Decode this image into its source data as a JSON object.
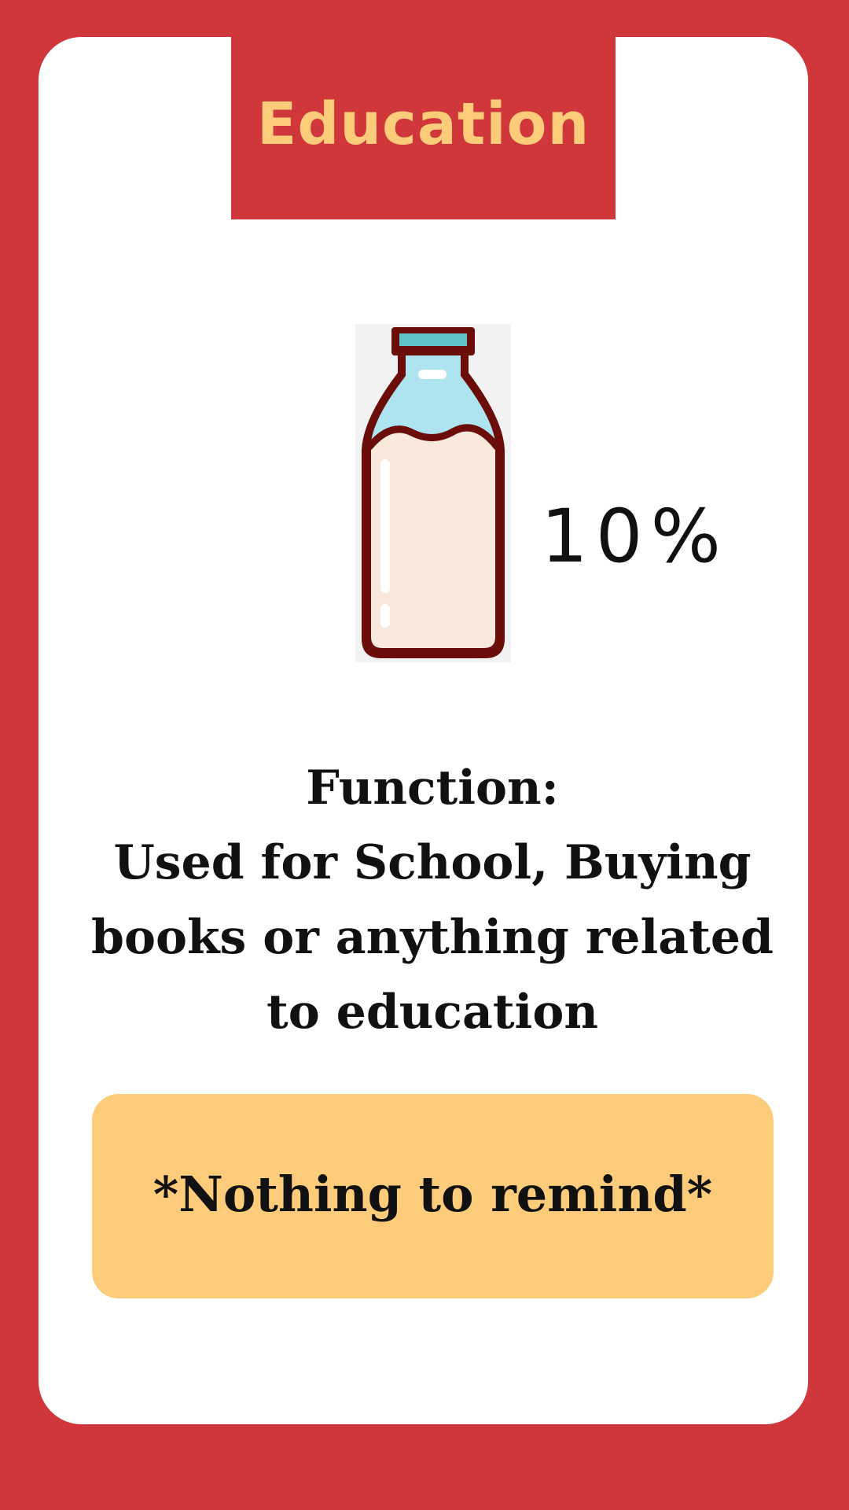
{
  "header": {
    "title": "Education"
  },
  "budget": {
    "icon": "milk-bottle-icon",
    "percentage_label": "10%",
    "percentage_value": 10
  },
  "function": {
    "heading": "Function:",
    "lines": [
      "Used for School, Buying",
      "books or anything related",
      "to education"
    ]
  },
  "reminder": {
    "text": "*Nothing to remind*"
  },
  "colors": {
    "background": "#cf373a",
    "card": "#ffffff",
    "header_text": "#fdcc7b",
    "reminder_box": "#fdcc7b",
    "text": "#111111"
  }
}
